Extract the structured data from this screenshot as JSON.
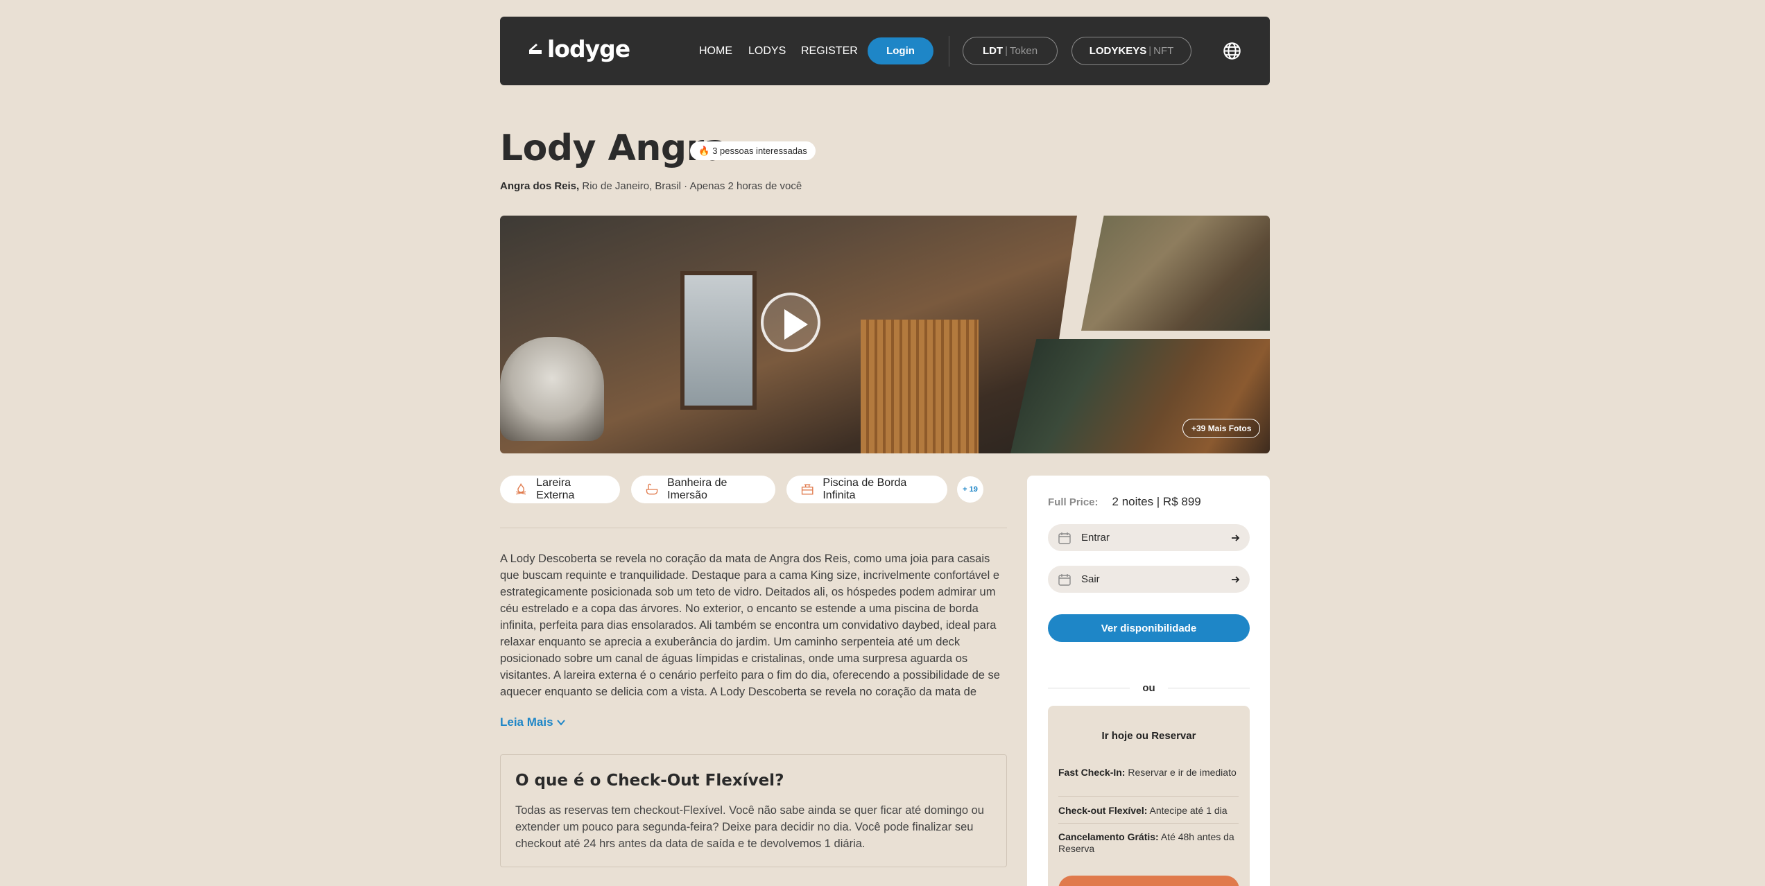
{
  "nav": {
    "logo": "lodyge",
    "links": [
      "HOME",
      "LODYS",
      "REGISTER"
    ],
    "login": "Login",
    "token_pill": {
      "main": "LDT",
      "sep": "|",
      "sub": "Token"
    },
    "nft_pill": {
      "main": "LODYKEYS",
      "sep": "|",
      "sub": "NFT"
    },
    "language_icon": "globe-icon"
  },
  "listing": {
    "title": "Lody Angra",
    "interest": "3 pessoas interessadas",
    "interest_icon": "fire-icon",
    "location_city": "Angra dos Reis,",
    "location_rest": " Rio de Janeiro, Brasil · Apenas 2 horas de você"
  },
  "gallery": {
    "play_icon": "play-icon",
    "more_photos": "+39 Mais Fotos"
  },
  "amenities": {
    "items": [
      {
        "label": "Lareira Externa",
        "icon": "fireplace-icon"
      },
      {
        "label": "Banheira de Imersão",
        "icon": "bathtub-icon"
      },
      {
        "label": "Piscina de Borda Infinita",
        "icon": "pool-icon"
      }
    ],
    "more": "+ 19"
  },
  "description": {
    "text": "A Lody Descoberta se revela no coração da mata de Angra dos Reis, como uma joia para casais que buscam requinte e tranquilidade. Destaque para a cama King size, incrivelmente confortável e estrategicamente posicionada sob um teto de vidro. Deitados ali, os hóspedes podem admirar um céu estrelado e a copa das árvores. No exterior, o encanto se estende a uma piscina de borda infinita, perfeita para dias ensolarados. Ali também se encontra um convidativo daybed, ideal para relaxar enquanto se aprecia a exuberância do jardim. Um caminho serpenteia até um deck posicionado sobre um canal de águas límpidas e cristalinas, onde uma surpresa aguarda os visitantes. A lareira externa é o cenário perfeito para o fim do dia, oferecendo a possibilidade de se aquecer enquanto se delicia com a vista. A Lody Descoberta se revela no coração da mata de",
    "read_more": "Leia Mais"
  },
  "flex_checkout": {
    "title": "O que é o Check-Out Flexível?",
    "body": "Todas as reservas tem checkout-Flexível. Você não sabe ainda se quer ficar até domingo ou extender um pouco para segunda-feira? Deixe para decidir no dia. Você pode finalizar seu checkout até 24 hrs antes da data de saída e te devolvemos 1 diária."
  },
  "booking": {
    "price_label": "Full Price:",
    "price_value": "2 noites | R$ 899",
    "checkin": "Entrar",
    "checkout": "Sair",
    "availability": "Ver disponibilidade",
    "or": "ou",
    "reserve_title": "Ir hoje ou Reservar",
    "features": [
      {
        "name": "Fast Check-In:",
        "text": " Reservar e ir de imediato"
      },
      {
        "name": "Check-out Flexível:",
        "text": " Antecipe até 1 dia"
      },
      {
        "name": "Cancelamento Grátis:",
        "text": " Até 48h antes da Reserva"
      }
    ]
  },
  "colors": {
    "background": "#e9e0d4",
    "navbar": "#2e2e2e",
    "accent_blue": "#1e86c7",
    "accent_orange": "#e07a4c"
  }
}
